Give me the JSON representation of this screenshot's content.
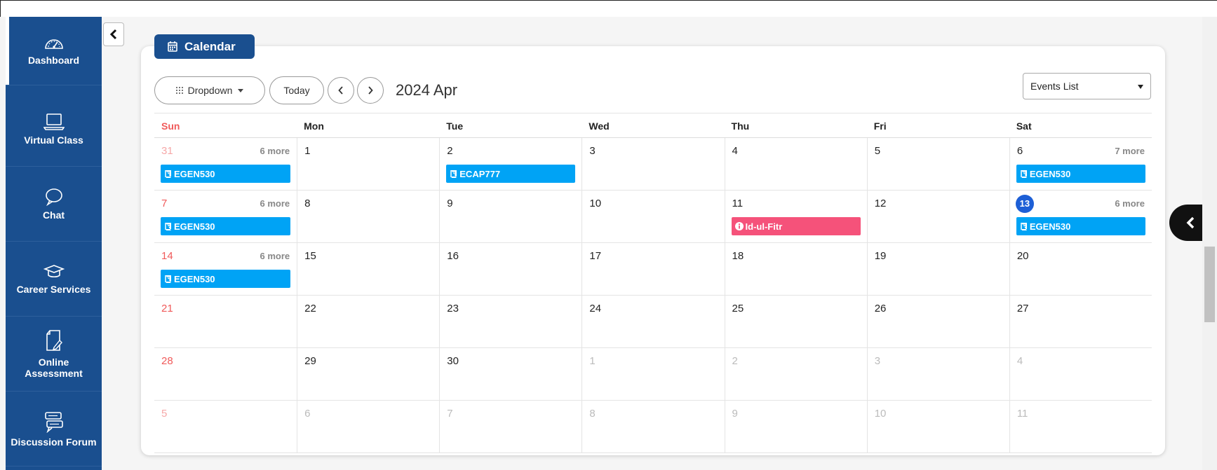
{
  "sidebar": {
    "items": [
      {
        "label": "Dashboard",
        "icon": "speedometer-icon"
      },
      {
        "label": "Virtual Class",
        "icon": "laptop-icon"
      },
      {
        "label": "Chat",
        "icon": "chat-bubble-icon"
      },
      {
        "label": "Career Services",
        "icon": "graduation-cap-icon"
      },
      {
        "label": "Online Assessment",
        "icon": "document-pen-icon"
      },
      {
        "label": "Discussion Forum",
        "icon": "forum-icon"
      }
    ]
  },
  "calendar": {
    "tab_label": "Calendar",
    "dropdown_label": "Dropdown",
    "today_label": "Today",
    "period": "2024 Apr",
    "view_select": "Events List",
    "weekdays": [
      "Sun",
      "Mon",
      "Tue",
      "Wed",
      "Thu",
      "Fri",
      "Sat"
    ],
    "weeks": [
      [
        {
          "num": "31",
          "other": true,
          "more": "6 more",
          "event": {
            "label": "EGEN530",
            "type": "course"
          }
        },
        {
          "num": "1"
        },
        {
          "num": "2",
          "event": {
            "label": "ECAP777",
            "type": "course"
          }
        },
        {
          "num": "3"
        },
        {
          "num": "4"
        },
        {
          "num": "5"
        },
        {
          "num": "6",
          "more": "7 more",
          "event": {
            "label": "EGEN530",
            "type": "course"
          }
        }
      ],
      [
        {
          "num": "7",
          "more": "6 more",
          "event": {
            "label": "EGEN530",
            "type": "course"
          }
        },
        {
          "num": "8"
        },
        {
          "num": "9"
        },
        {
          "num": "10"
        },
        {
          "num": "11",
          "event": {
            "label": "Id-ul-Fitr",
            "type": "holiday"
          }
        },
        {
          "num": "12"
        },
        {
          "num": "13",
          "today": true,
          "more": "6 more",
          "event": {
            "label": "EGEN530",
            "type": "course"
          }
        }
      ],
      [
        {
          "num": "14",
          "more": "6 more",
          "event": {
            "label": "EGEN530",
            "type": "course"
          }
        },
        {
          "num": "15"
        },
        {
          "num": "16"
        },
        {
          "num": "17"
        },
        {
          "num": "18"
        },
        {
          "num": "19"
        },
        {
          "num": "20"
        }
      ],
      [
        {
          "num": "21"
        },
        {
          "num": "22"
        },
        {
          "num": "23"
        },
        {
          "num": "24"
        },
        {
          "num": "25"
        },
        {
          "num": "26"
        },
        {
          "num": "27"
        }
      ],
      [
        {
          "num": "28"
        },
        {
          "num": "29"
        },
        {
          "num": "30"
        },
        {
          "num": "1",
          "other": true
        },
        {
          "num": "2",
          "other": true
        },
        {
          "num": "3",
          "other": true
        },
        {
          "num": "4",
          "other": true
        }
      ],
      [
        {
          "num": "5",
          "other": true
        },
        {
          "num": "6",
          "other": true
        },
        {
          "num": "7",
          "other": true
        },
        {
          "num": "8",
          "other": true
        },
        {
          "num": "9",
          "other": true
        },
        {
          "num": "10",
          "other": true
        },
        {
          "num": "11",
          "other": true
        }
      ]
    ]
  },
  "colors": {
    "brand": "#1a4f8f",
    "course_event": "#00a3f5",
    "holiday_event": "#f5527a",
    "today": "#1d5fd6",
    "sunday": "#f05a5a"
  }
}
